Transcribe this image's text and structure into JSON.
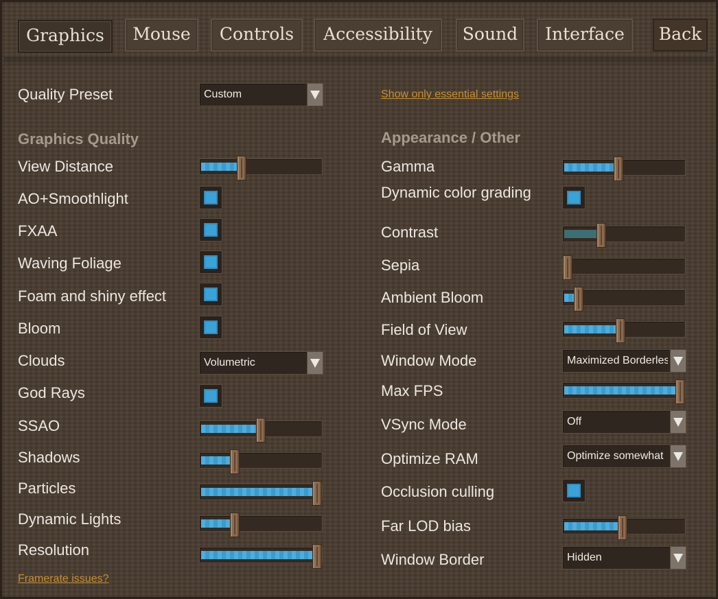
{
  "tabs": [
    {
      "label": "Graphics",
      "active": true
    },
    {
      "label": "Mouse",
      "active": false
    },
    {
      "label": "Controls",
      "active": false
    },
    {
      "label": "Accessibility",
      "active": false
    },
    {
      "label": "Sound",
      "active": false
    },
    {
      "label": "Interface",
      "active": false
    }
  ],
  "back_label": "Back",
  "quality_preset": {
    "label": "Quality Preset",
    "value": "Custom"
  },
  "essential_link": "Show only essential settings",
  "left_section_title": "Graphics Quality",
  "right_section_title": "Appearance / Other",
  "left": {
    "view_distance": {
      "label": "View Distance",
      "level": 0.33
    },
    "ao_smoothlight": {
      "label": "AO+Smoothlight",
      "checked": true
    },
    "fxaa": {
      "label": "FXAA",
      "checked": true
    },
    "waving_foliage": {
      "label": "Waving Foliage",
      "checked": true
    },
    "foam_shiny": {
      "label": "Foam and shiny effect",
      "checked": true
    },
    "bloom": {
      "label": "Bloom",
      "checked": true
    },
    "clouds": {
      "label": "Clouds",
      "value": "Volumetric"
    },
    "god_rays": {
      "label": "God Rays",
      "checked": true
    },
    "ssao": {
      "label": "SSAO",
      "level": 0.5
    },
    "shadows": {
      "label": "Shadows",
      "level": 0.27
    },
    "particles": {
      "label": "Particles",
      "level": 1.0
    },
    "dynamic_lights": {
      "label": "Dynamic Lights",
      "level": 0.27
    },
    "resolution": {
      "label": "Resolution",
      "level": 1.0
    }
  },
  "right": {
    "gamma": {
      "label": "Gamma",
      "level": 0.45
    },
    "dynamic_color_grading": {
      "label": "Dynamic color grading",
      "checked": true
    },
    "contrast": {
      "label": "Contrast",
      "level": 0.3
    },
    "sepia": {
      "label": "Sepia",
      "level": 0.0
    },
    "ambient_bloom": {
      "label": "Ambient Bloom",
      "level": 0.1
    },
    "field_of_view": {
      "label": "Field of View",
      "level": 0.47
    },
    "window_mode": {
      "label": "Window Mode",
      "value": "Maximized Borderless"
    },
    "max_fps": {
      "label": "Max FPS",
      "level": 1.0
    },
    "vsync_mode": {
      "label": "VSync Mode",
      "value": "Off"
    },
    "optimize_ram": {
      "label": "Optimize RAM",
      "value": "Optimize somewhat"
    },
    "occlusion_culling": {
      "label": "Occlusion culling",
      "checked": true
    },
    "far_lod_bias": {
      "label": "Far LOD bias",
      "level": 0.49
    },
    "window_border": {
      "label": "Window Border",
      "value": "Hidden"
    }
  },
  "framerate_link": "Framerate issues?",
  "colors": {
    "accent_blue": "#3ea6db",
    "link_orange": "#c78f2f",
    "background_brown": "#4a3d31"
  }
}
